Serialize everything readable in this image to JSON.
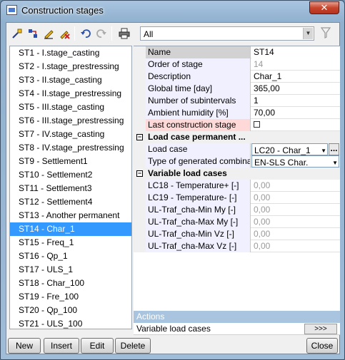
{
  "window": {
    "title": "Construction stages",
    "close_glyph": "✕"
  },
  "toolbar": {
    "icons": [
      "new-stage-icon",
      "copy-stage-icon",
      "edit-icon",
      "delete-icon",
      "undo-icon",
      "redo-icon",
      "print-icon",
      "filter-icon"
    ],
    "filter_combo": {
      "value": "All"
    }
  },
  "stages": [
    "ST1 - I.stage_casting",
    "ST2 - I.stage_prestressing",
    "ST3 - II.stage_casting",
    "ST4 - II.stage_prestressing",
    "ST5 - III.stage_casting",
    "ST6 - III.stage_prestressing",
    "ST7 - IV.stage_casting",
    "ST8 - IV.stage_prestressing",
    "ST9 - Settlement1",
    "ST10 - Settlement2",
    "ST11 - Settlement3",
    "ST12 - Settlement4",
    "ST13 - Another permanent",
    "ST14 - Char_1",
    "ST15 - Freq_1",
    "ST16 - Qp_1",
    "ST17 - ULS_1",
    "ST18 - Char_100",
    "ST19 - Fre_100",
    "ST20 - Qp_100",
    "ST21 - ULS_100"
  ],
  "selected_stage": "ST14 - Char_1",
  "properties": {
    "name": {
      "label": "Name",
      "value": "ST14"
    },
    "order": {
      "label": "Order of stage",
      "value": "14"
    },
    "description": {
      "label": "Description",
      "value": "Char_1"
    },
    "global_time": {
      "label": "Global time [day]",
      "value": "365,00"
    },
    "subintervals": {
      "label": "Number of subintervals",
      "value": "1"
    },
    "humidity": {
      "label": "Ambient humidity [%]",
      "value": "70,00"
    },
    "last_stage": {
      "label": "Last construction stage",
      "checked": false
    },
    "cat_permanent": {
      "label": "Load case permanent ...",
      "toggle": "−"
    },
    "load_case": {
      "label": "Load case",
      "value": "LC20 - Char_1",
      "ellipsis": "..."
    },
    "combination_type": {
      "label": "Type of generated combina...",
      "value": "EN-SLS Char."
    },
    "cat_variable": {
      "label": "Variable load cases",
      "toggle": "−"
    },
    "variable": [
      {
        "label": "LC18 - Temperature+ [-]",
        "value": "0,00"
      },
      {
        "label": "LC19 - Temperature- [-]",
        "value": "0,00"
      },
      {
        "label": "UL-Traf_cha-Min My [-]",
        "value": "0,00"
      },
      {
        "label": "UL-Traf_cha-Max My [-]",
        "value": "0,00"
      },
      {
        "label": "UL-Traf_cha-Min Vz [-]",
        "value": "0,00"
      },
      {
        "label": "UL-Traf_cha-Max Vz [-]",
        "value": "0,00"
      }
    ]
  },
  "actions": {
    "header": "Actions",
    "item_label": "Variable load cases",
    "item_button": ">>>"
  },
  "buttons": {
    "new": "New",
    "insert": "Insert",
    "edit": "Edit",
    "delete": "Delete",
    "close": "Close"
  }
}
